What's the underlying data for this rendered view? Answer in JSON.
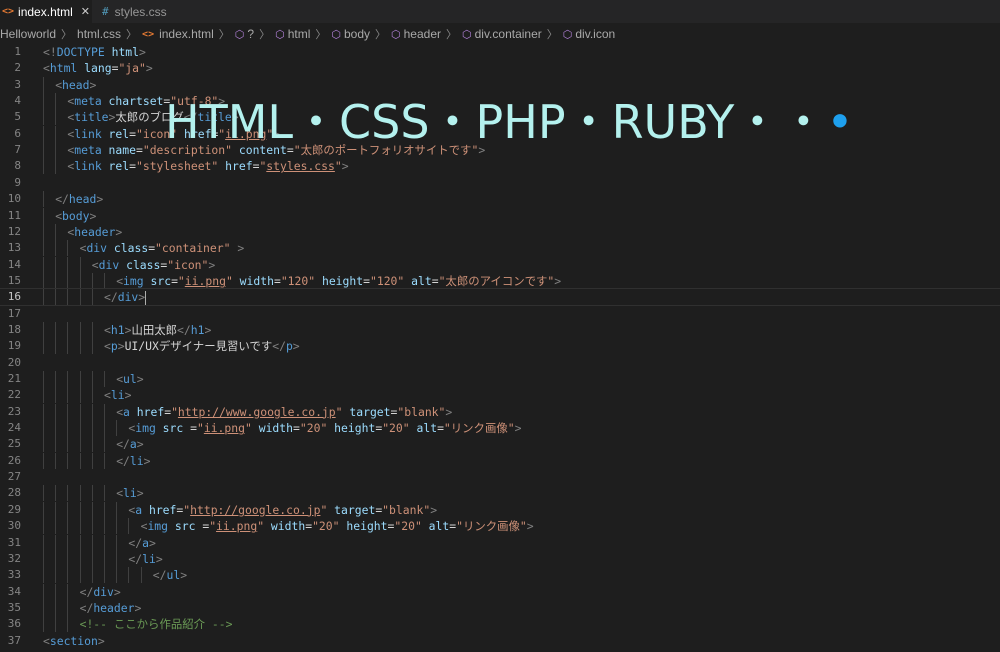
{
  "tabs": [
    {
      "label": "index.html",
      "active": true,
      "icon": "html-file-icon",
      "close": "✕"
    },
    {
      "label": "styles.css",
      "active": false,
      "icon": "css-file-icon"
    }
  ],
  "breadcrumb": [
    "Helloworld",
    "html.css",
    "index.html",
    "?",
    "html",
    "body",
    "header",
    "div.container",
    "div.icon"
  ],
  "overlay": {
    "text": "HTML・CSS・PHP・RUBY・・",
    "last_dot": "•"
  },
  "current_line": 16,
  "code_lines": [
    {
      "n": 1,
      "indent": 0,
      "tokens": [
        [
          "b",
          "<!"
        ],
        [
          "t",
          "DOCTYPE"
        ],
        [
          "a",
          " html"
        ],
        [
          "b",
          ">"
        ]
      ]
    },
    {
      "n": 2,
      "indent": 0,
      "tokens": [
        [
          "b",
          "<"
        ],
        [
          "t",
          "html"
        ],
        [
          "a",
          " lang"
        ],
        [
          "x",
          "="
        ],
        [
          "s",
          "\"ja\""
        ],
        [
          "b",
          ">"
        ]
      ]
    },
    {
      "n": 3,
      "indent": 1,
      "tokens": [
        [
          "b",
          "<"
        ],
        [
          "t",
          "head"
        ],
        [
          "b",
          ">"
        ]
      ]
    },
    {
      "n": 4,
      "indent": 2,
      "tokens": [
        [
          "b",
          "<"
        ],
        [
          "t",
          "meta"
        ],
        [
          "a",
          " chartset"
        ],
        [
          "x",
          "="
        ],
        [
          "s",
          "\"utf-8\""
        ],
        [
          "b",
          ">"
        ]
      ]
    },
    {
      "n": 5,
      "indent": 2,
      "tokens": [
        [
          "b",
          "<"
        ],
        [
          "t",
          "title"
        ],
        [
          "b",
          ">"
        ],
        [
          "x",
          "太郎のブログ"
        ],
        [
          "b",
          "</"
        ],
        [
          "t",
          "title"
        ],
        [
          "b",
          ">"
        ]
      ]
    },
    {
      "n": 6,
      "indent": 2,
      "tokens": [
        [
          "b",
          "<"
        ],
        [
          "t",
          "link"
        ],
        [
          "a",
          " rel"
        ],
        [
          "x",
          "="
        ],
        [
          "s",
          "\"icon\""
        ],
        [
          "a",
          " href"
        ],
        [
          "x",
          "="
        ],
        [
          "s",
          "\""
        ],
        [
          "l",
          "ii.png"
        ],
        [
          "s",
          "\""
        ],
        [
          "b",
          ">"
        ]
      ]
    },
    {
      "n": 7,
      "indent": 2,
      "tokens": [
        [
          "b",
          "<"
        ],
        [
          "t",
          "meta"
        ],
        [
          "a",
          " name"
        ],
        [
          "x",
          "="
        ],
        [
          "s",
          "\"description\""
        ],
        [
          "a",
          " content"
        ],
        [
          "x",
          "="
        ],
        [
          "s",
          "\"太郎のポートフォリオサイトです\""
        ],
        [
          "b",
          ">"
        ]
      ]
    },
    {
      "n": 8,
      "indent": 2,
      "tokens": [
        [
          "b",
          "<"
        ],
        [
          "t",
          "link"
        ],
        [
          "a",
          " rel"
        ],
        [
          "x",
          "="
        ],
        [
          "s",
          "\"stylesheet\""
        ],
        [
          "a",
          " href"
        ],
        [
          "x",
          "="
        ],
        [
          "s",
          "\""
        ],
        [
          "l",
          "styles.css"
        ],
        [
          "s",
          "\""
        ],
        [
          "b",
          ">"
        ]
      ]
    },
    {
      "n": 9,
      "indent": 0,
      "tokens": []
    },
    {
      "n": 10,
      "indent": 1,
      "tokens": [
        [
          "b",
          "</"
        ],
        [
          "t",
          "head"
        ],
        [
          "b",
          ">"
        ]
      ]
    },
    {
      "n": 11,
      "indent": 1,
      "tokens": [
        [
          "b",
          "<"
        ],
        [
          "t",
          "body"
        ],
        [
          "b",
          ">"
        ]
      ]
    },
    {
      "n": 12,
      "indent": 2,
      "tokens": [
        [
          "b",
          "<"
        ],
        [
          "t",
          "header"
        ],
        [
          "b",
          ">"
        ]
      ]
    },
    {
      "n": 13,
      "indent": 3,
      "tokens": [
        [
          "b",
          "<"
        ],
        [
          "t",
          "div"
        ],
        [
          "a",
          " class"
        ],
        [
          "x",
          "="
        ],
        [
          "s",
          "\"container\""
        ],
        [
          "x",
          " "
        ],
        [
          "b",
          ">"
        ]
      ]
    },
    {
      "n": 14,
      "indent": 4,
      "tokens": [
        [
          "b",
          "<"
        ],
        [
          "t",
          "div"
        ],
        [
          "a",
          " class"
        ],
        [
          "x",
          "="
        ],
        [
          "s",
          "\"icon\""
        ],
        [
          "b",
          ">"
        ]
      ]
    },
    {
      "n": 15,
      "indent": 6,
      "tokens": [
        [
          "b",
          "<"
        ],
        [
          "t",
          "img"
        ],
        [
          "a",
          " src"
        ],
        [
          "x",
          "="
        ],
        [
          "s",
          "\""
        ],
        [
          "l",
          "ii.png"
        ],
        [
          "s",
          "\""
        ],
        [
          "a",
          " width"
        ],
        [
          "x",
          "="
        ],
        [
          "s",
          "\"120\""
        ],
        [
          "a",
          " height"
        ],
        [
          "x",
          "="
        ],
        [
          "s",
          "\"120\""
        ],
        [
          "a",
          " alt"
        ],
        [
          "x",
          "="
        ],
        [
          "s",
          "\"太郎のアイコンです\""
        ],
        [
          "b",
          ">"
        ]
      ]
    },
    {
      "n": 16,
      "indent": 5,
      "tokens": [
        [
          "b",
          "</"
        ],
        [
          "t",
          "div"
        ],
        [
          "b",
          ">"
        ]
      ]
    },
    {
      "n": 17,
      "indent": 0,
      "tokens": []
    },
    {
      "n": 18,
      "indent": 5,
      "tokens": [
        [
          "b",
          "<"
        ],
        [
          "t",
          "h1"
        ],
        [
          "b",
          ">"
        ],
        [
          "x",
          "山田太郎"
        ],
        [
          "b",
          "</"
        ],
        [
          "t",
          "h1"
        ],
        [
          "b",
          ">"
        ]
      ]
    },
    {
      "n": 19,
      "indent": 5,
      "tokens": [
        [
          "b",
          "<"
        ],
        [
          "t",
          "p"
        ],
        [
          "b",
          ">"
        ],
        [
          "x",
          "UI/UXデザイナー見習いです"
        ],
        [
          "b",
          "</"
        ],
        [
          "t",
          "p"
        ],
        [
          "b",
          ">"
        ]
      ]
    },
    {
      "n": 20,
      "indent": 0,
      "tokens": []
    },
    {
      "n": 21,
      "indent": 6,
      "tokens": [
        [
          "b",
          "<"
        ],
        [
          "t",
          "ul"
        ],
        [
          "b",
          ">"
        ]
      ]
    },
    {
      "n": 22,
      "indent": 5,
      "tokens": [
        [
          "b",
          "<"
        ],
        [
          "t",
          "li"
        ],
        [
          "b",
          ">"
        ]
      ]
    },
    {
      "n": 23,
      "indent": 6,
      "tokens": [
        [
          "b",
          "<"
        ],
        [
          "t",
          "a"
        ],
        [
          "a",
          " href"
        ],
        [
          "x",
          "="
        ],
        [
          "s",
          "\""
        ],
        [
          "l",
          "http://www.google.co.jp"
        ],
        [
          "s",
          "\""
        ],
        [
          "a",
          " target"
        ],
        [
          "x",
          "="
        ],
        [
          "s",
          "\"blank\""
        ],
        [
          "b",
          ">"
        ]
      ]
    },
    {
      "n": 24,
      "indent": 7,
      "tokens": [
        [
          "b",
          "<"
        ],
        [
          "t",
          "img"
        ],
        [
          "a",
          " src "
        ],
        [
          "x",
          "="
        ],
        [
          "s",
          "\""
        ],
        [
          "l",
          "ii.png"
        ],
        [
          "s",
          "\""
        ],
        [
          "a",
          " width"
        ],
        [
          "x",
          "="
        ],
        [
          "s",
          "\"20\""
        ],
        [
          "a",
          " height"
        ],
        [
          "x",
          "="
        ],
        [
          "s",
          "\"20\""
        ],
        [
          "a",
          " alt"
        ],
        [
          "x",
          "="
        ],
        [
          "s",
          "\"リンク画像\""
        ],
        [
          "b",
          ">"
        ]
      ]
    },
    {
      "n": 25,
      "indent": 6,
      "tokens": [
        [
          "b",
          "</"
        ],
        [
          "t",
          "a"
        ],
        [
          "b",
          ">"
        ]
      ]
    },
    {
      "n": 26,
      "indent": 6,
      "tokens": [
        [
          "b",
          "</"
        ],
        [
          "t",
          "li"
        ],
        [
          "b",
          ">"
        ]
      ]
    },
    {
      "n": 27,
      "indent": 0,
      "tokens": []
    },
    {
      "n": 28,
      "indent": 6,
      "tokens": [
        [
          "b",
          "<"
        ],
        [
          "t",
          "li"
        ],
        [
          "b",
          ">"
        ]
      ]
    },
    {
      "n": 29,
      "indent": 7,
      "tokens": [
        [
          "b",
          "<"
        ],
        [
          "t",
          "a"
        ],
        [
          "a",
          " href"
        ],
        [
          "x",
          "="
        ],
        [
          "s",
          "\""
        ],
        [
          "l",
          "http://google.co.jp"
        ],
        [
          "s",
          "\""
        ],
        [
          "a",
          " target"
        ],
        [
          "x",
          "="
        ],
        [
          "s",
          "\"blank\""
        ],
        [
          "b",
          ">"
        ]
      ]
    },
    {
      "n": 30,
      "indent": 8,
      "tokens": [
        [
          "b",
          "<"
        ],
        [
          "t",
          "img"
        ],
        [
          "a",
          " src "
        ],
        [
          "x",
          "="
        ],
        [
          "s",
          "\""
        ],
        [
          "l",
          "ii.png"
        ],
        [
          "s",
          "\""
        ],
        [
          "a",
          " width"
        ],
        [
          "x",
          "="
        ],
        [
          "s",
          "\"20\""
        ],
        [
          "a",
          " height"
        ],
        [
          "x",
          "="
        ],
        [
          "s",
          "\"20\""
        ],
        [
          "a",
          " alt"
        ],
        [
          "x",
          "="
        ],
        [
          "s",
          "\"リンク画像\""
        ],
        [
          "b",
          ">"
        ]
      ]
    },
    {
      "n": 31,
      "indent": 7,
      "tokens": [
        [
          "b",
          "</"
        ],
        [
          "t",
          "a"
        ],
        [
          "b",
          ">"
        ]
      ]
    },
    {
      "n": 32,
      "indent": 7,
      "tokens": [
        [
          "b",
          "</"
        ],
        [
          "t",
          "li"
        ],
        [
          "b",
          ">"
        ]
      ]
    },
    {
      "n": 33,
      "indent": 9,
      "tokens": [
        [
          "b",
          "</"
        ],
        [
          "t",
          "ul"
        ],
        [
          "b",
          ">"
        ]
      ]
    },
    {
      "n": 34,
      "indent": 3,
      "tokens": [
        [
          "b",
          "</"
        ],
        [
          "t",
          "div"
        ],
        [
          "b",
          ">"
        ]
      ]
    },
    {
      "n": 35,
      "indent": 3,
      "tokens": [
        [
          "b",
          "</"
        ],
        [
          "t",
          "header"
        ],
        [
          "b",
          ">"
        ]
      ]
    },
    {
      "n": 36,
      "indent": 3,
      "tokens": [
        [
          "c",
          "<!-- ここから作品紹介 -->"
        ]
      ]
    },
    {
      "n": 37,
      "indent": 0,
      "tokens": [
        [
          "b",
          "<"
        ],
        [
          "t",
          "section"
        ],
        [
          "b",
          ">"
        ]
      ]
    }
  ]
}
